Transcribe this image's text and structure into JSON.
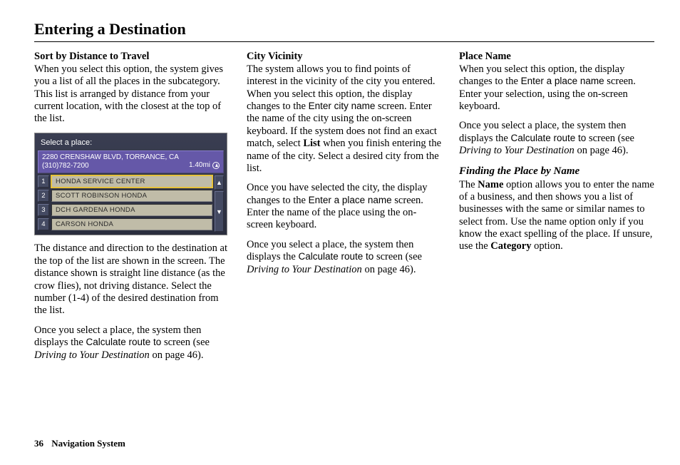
{
  "page": {
    "title": "Entering a Destination",
    "number": "36",
    "section": "Navigation System"
  },
  "col1": {
    "h1": "Sort by Distance to Travel",
    "p1": "When you select this option, the system gives you a list of all the places in the subcategory. This list is arranged by distance from your current location, with the closest at the top of the list.",
    "p2": "The distance and direction to the destination at the top of the list are shown in the screen. The distance shown is straight line distance (as the crow flies), not driving distance. Select the number (1-4) of the desired destination from the list.",
    "p3a": "Once you select a place, the system then displays the ",
    "p3calc": "Calculate route to",
    "p3b": " screen (see ",
    "p3ref": "Driving to Your Destination",
    "p3c": " on page 46)."
  },
  "navscreen": {
    "prompt": "Select a place:",
    "sel_addr": "2280 CRENSHAW BLVD, TORRANCE, CA",
    "sel_phone": "(310)782-7200",
    "sel_dist": "1.40mi",
    "rows": [
      {
        "n": "1",
        "t": "HONDA SERVICE CENTER"
      },
      {
        "n": "2",
        "t": "SCOTT ROBINSON HONDA"
      },
      {
        "n": "3",
        "t": "DCH GARDENA HONDA"
      },
      {
        "n": "4",
        "t": "CARSON HONDA"
      }
    ],
    "up": "▲",
    "down": "▼"
  },
  "col2": {
    "h1": "City Vicinity",
    "p1a": "The system allows you to find points of interest in the vicinity of the city you entered. When you select this option, the display changes to the ",
    "p1screen": "Enter city name",
    "p1b": " screen. Enter the name of the city using the on-screen keyboard. If the system does not find an exact match, select ",
    "p1list": "List",
    "p1c": " when you finish entering the name of the city. Select a desired city from the list.",
    "p2a": "Once you have selected the city, the display changes to the ",
    "p2screen": "Enter a place name",
    "p2b": " screen. Enter the name of the place using the on-screen keyboard.",
    "p3a": "Once you select a place, the system then displays the ",
    "p3calc": "Calculate route to",
    "p3b": " screen (see ",
    "p3ref": "Driving to Your Destination",
    "p3c": " on page 46)."
  },
  "col3": {
    "h1": "Place Name",
    "p1a": "When you select this option, the display changes to the ",
    "p1screen": "Enter a place name",
    "p1b": " screen. Enter your selection, using the on-screen keyboard.",
    "p2a": "Once you select a place, the system then displays the ",
    "p2calc": "Calculate route to",
    "p2b": " screen (see ",
    "p2ref": "Driving to Your Destination",
    "p2c": " on page 46).",
    "h2": "Finding the Place by Name",
    "p3a": "The ",
    "p3name": "Name",
    "p3b": " option allows you to enter the name of a business, and then shows you a list of businesses with the same or similar names to select from. Use the name option only if you know the exact spelling of the place. If unsure, use the ",
    "p3cat": "Category",
    "p3c": " option."
  }
}
